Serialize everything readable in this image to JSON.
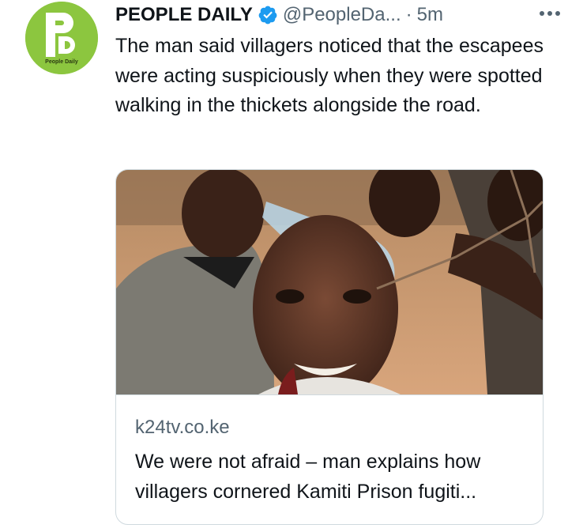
{
  "tweet": {
    "author": {
      "display_name": "PEOPLE DAILY",
      "handle": "@PeopleDa...",
      "verified_icon": "verified-badge-icon",
      "avatar_text": "People Daily"
    },
    "separator": "·",
    "time": "5m",
    "more_icon": "more-horizontal-icon",
    "text": "The man said villagers noticed that the escapees were acting suspiciously when they were spotted walking in the thickets alongside the road."
  },
  "card": {
    "image_icon": "article-photo",
    "domain": "k24tv.co.ke",
    "title": "We were not afraid – man explains how villagers cornered Kamiti Prison fugiti..."
  },
  "colors": {
    "brand_green": "#8cc63f",
    "verified_blue": "#1d9bf0",
    "secondary_text": "#536471",
    "border": "#cfd9de"
  }
}
